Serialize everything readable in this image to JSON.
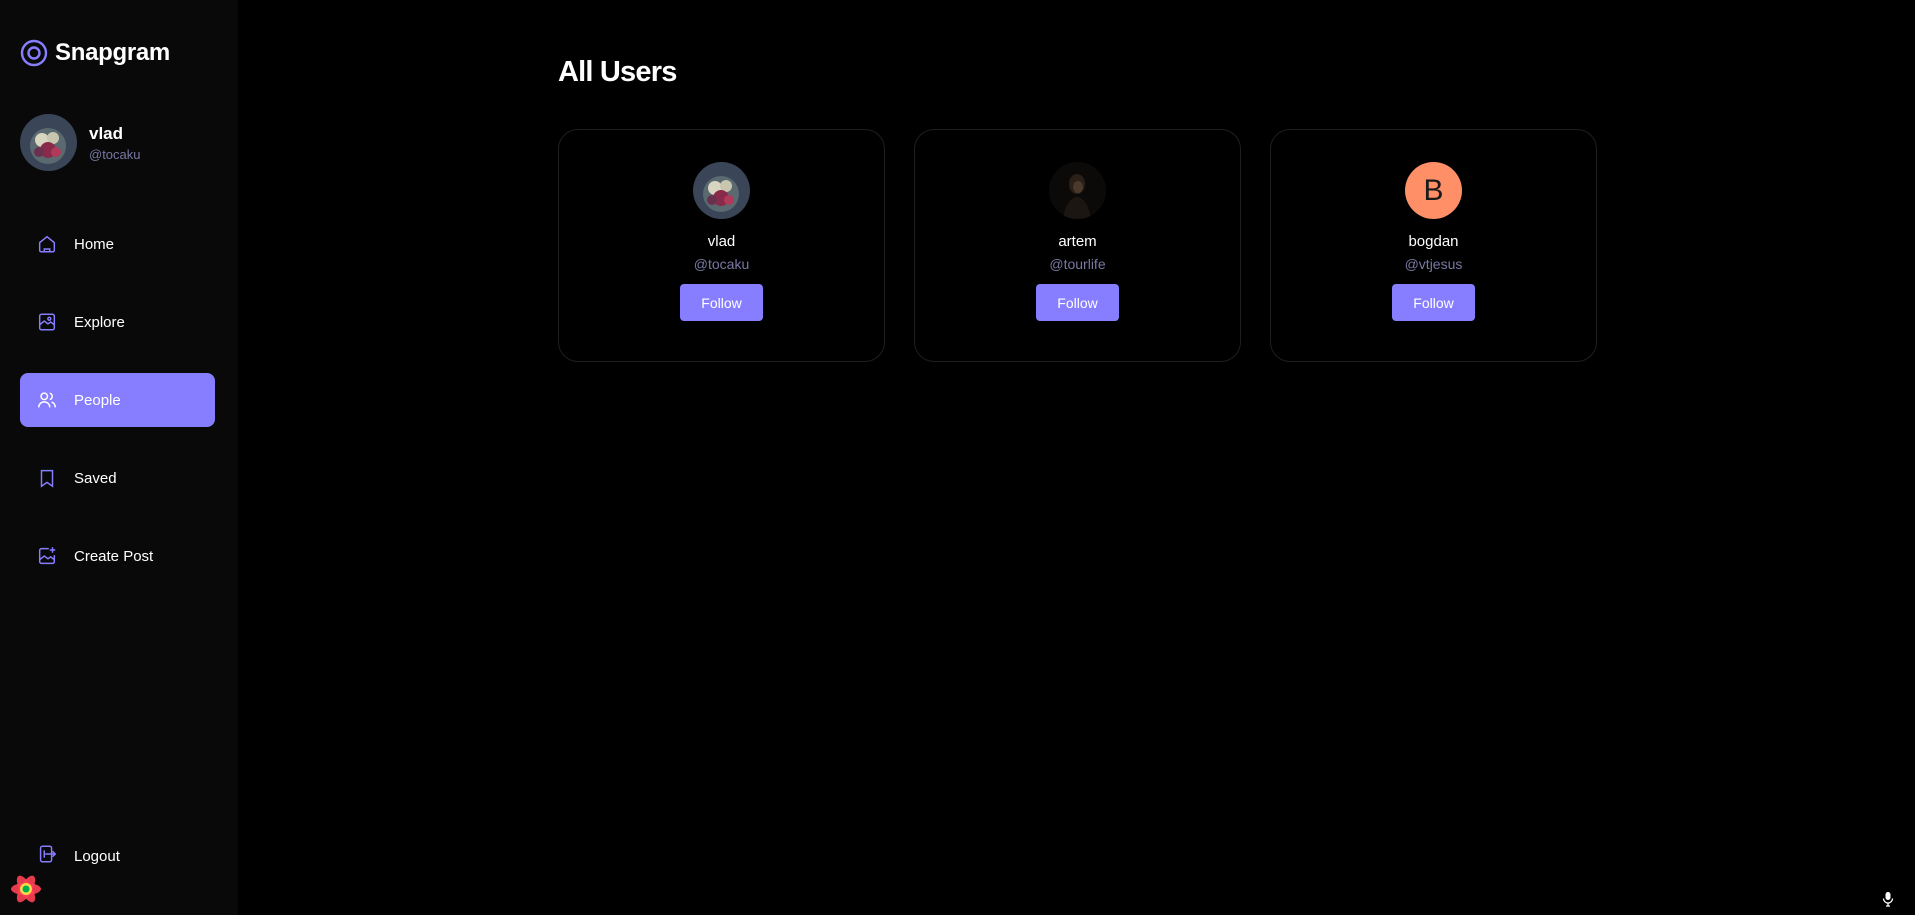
{
  "app": {
    "name": "Snapgram",
    "accent": "#877eff"
  },
  "sidebar": {
    "profile": {
      "name": "vlad",
      "handle": "@tocaku"
    },
    "items": [
      {
        "label": "Home",
        "icon": "home-icon",
        "active": false
      },
      {
        "label": "Explore",
        "icon": "explore-icon",
        "active": false
      },
      {
        "label": "People",
        "icon": "people-icon",
        "active": true
      },
      {
        "label": "Saved",
        "icon": "bookmark-icon",
        "active": false
      },
      {
        "label": "Create Post",
        "icon": "create-post-icon",
        "active": false
      }
    ],
    "logout_label": "Logout"
  },
  "main": {
    "title": "All Users",
    "users": [
      {
        "name": "vlad",
        "handle": "@tocaku",
        "follow_label": "Follow",
        "avatar": "photo"
      },
      {
        "name": "artem",
        "handle": "@tourlife",
        "follow_label": "Follow",
        "avatar": "photo"
      },
      {
        "name": "bogdan",
        "handle": "@vtjesus",
        "follow_label": "Follow",
        "avatar_letter": "B",
        "avatar_color": "#ff8f66"
      }
    ]
  }
}
